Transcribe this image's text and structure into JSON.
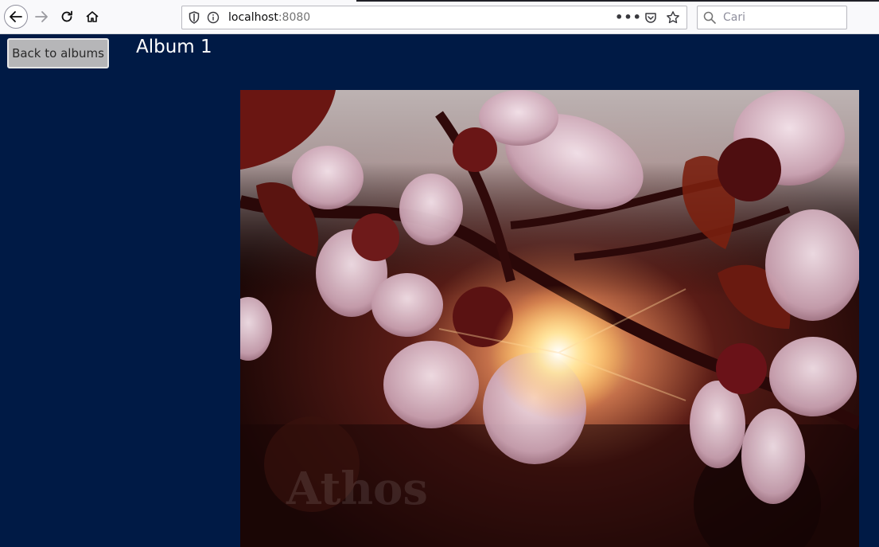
{
  "browser": {
    "url_host": "localhost",
    "url_port": ":8080",
    "search_placeholder": "Cari",
    "icons": {
      "back": "arrow-left-icon",
      "forward": "arrow-right-icon",
      "reload": "reload-icon",
      "home": "home-icon",
      "tracking": "shield-icon",
      "info": "info-icon",
      "page_actions": "more-dots-icon",
      "pocket": "pocket-icon",
      "bookmark": "star-icon",
      "search": "magnifier-icon"
    }
  },
  "page": {
    "back_button_label": "Back to albums",
    "album_title": "Album 1",
    "photo": {
      "description_icon": "photo-cherry-blossoms",
      "watermark": "Athos"
    },
    "colors": {
      "background": "#001a45",
      "button_bg": "#b6b6b8"
    }
  }
}
